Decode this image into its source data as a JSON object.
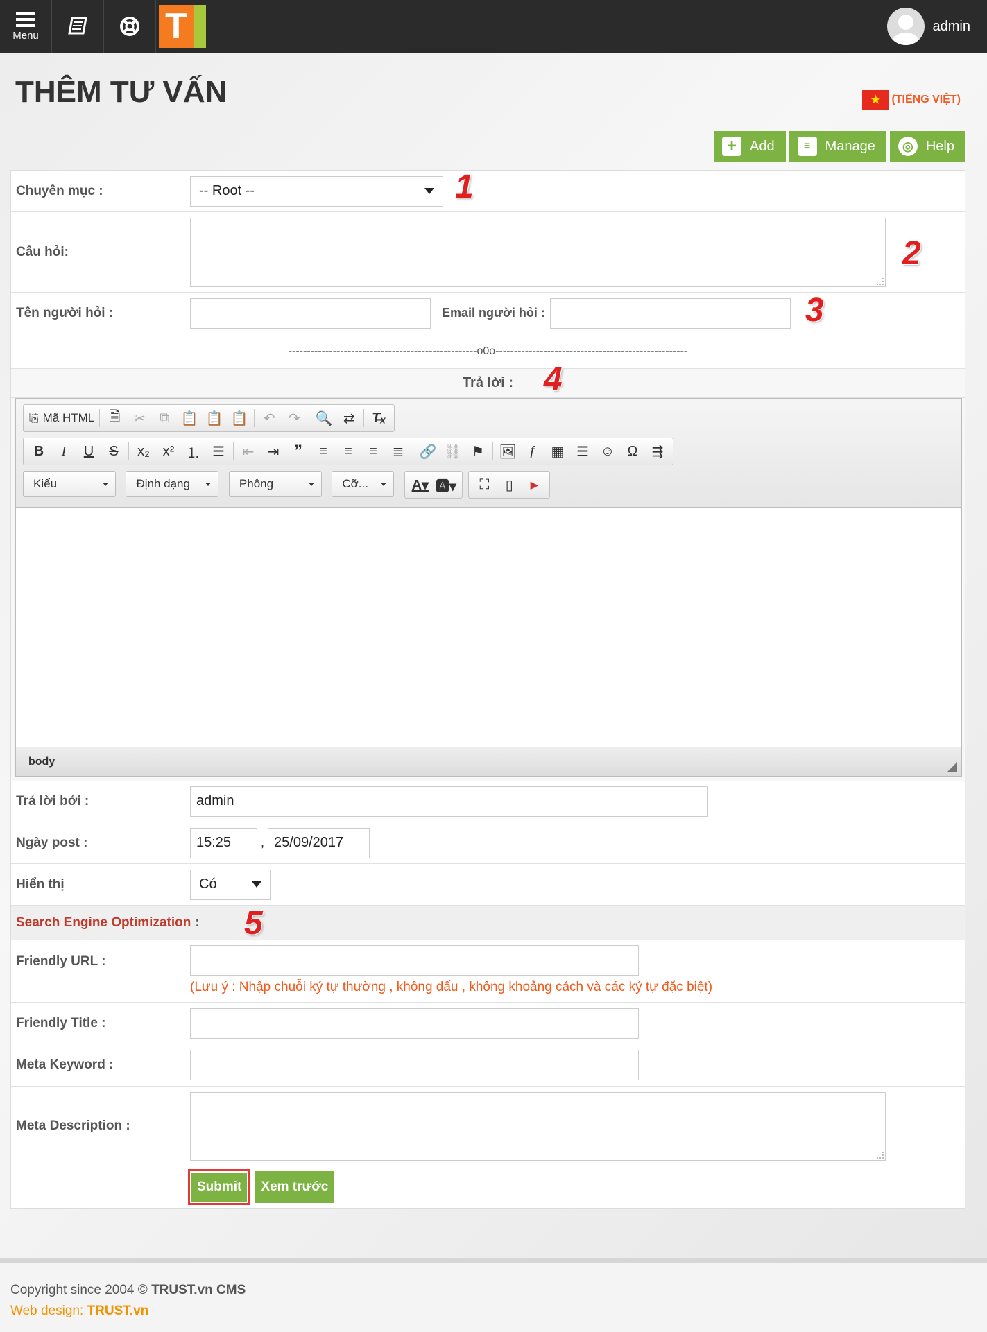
{
  "topbar": {
    "menu_label": "Menu",
    "logo_letter": "T",
    "user_name": "admin"
  },
  "page": {
    "title": "THÊM TƯ VẤN",
    "language": "(TIẾNG VIỆT)",
    "flag_star": "★"
  },
  "actions": {
    "add": "Add",
    "manage": "Manage",
    "help": "Help"
  },
  "form": {
    "category_label": "Chuyên mục  :",
    "category_value": "-- Root --",
    "question_label": "Câu hỏi:",
    "asker_name_label": "Tên người hỏi :",
    "asker_email_label": "Email người hỏi :",
    "separator": "---------------------------------------------------o0o----------------------------------------------------",
    "reply_label": "Trả lời   :",
    "replied_by_label": "Trả lời bởi :",
    "replied_by_value": "admin",
    "post_date_label": "Ngày post :",
    "post_time": "15:25",
    "post_comma": ",",
    "post_date": "25/09/2017",
    "display_label": "Hiển thị",
    "display_value": "Có",
    "seo_label": "Search Engine Optimization",
    "seo_colon": ":",
    "friendly_url_label": "Friendly URL :",
    "friendly_url_note": "(Lưu ý : Nhập chuỗi ký tự thường , không dấu , không khoảng cách và các ký tự đặc biệt)",
    "friendly_title_label": "Friendly Title :",
    "meta_keyword_label": "Meta Keyword :",
    "meta_description_label": "Meta Description :",
    "submit": "Submit",
    "preview": "Xem trước"
  },
  "editor": {
    "source_button": "Mã HTML",
    "style_combo": "Kiểu",
    "format_combo": "Định dạng",
    "font_combo": "Phông",
    "size_combo": "Cỡ...",
    "path": "body"
  },
  "annotations": [
    "1",
    "2",
    "3",
    "4",
    "5"
  ],
  "footer": {
    "copyright_prefix": "Copyright since 2004 ©",
    "copyright_brand": "TRUST.vn CMS",
    "webdesign_prefix": "Web design:",
    "webdesign_brand": "TRUST.vn"
  },
  "colors": {
    "accent_green": "#7cb342",
    "topbar": "#2b2b2b",
    "orange": "#f47b20",
    "annotation_red": "#e02020"
  }
}
